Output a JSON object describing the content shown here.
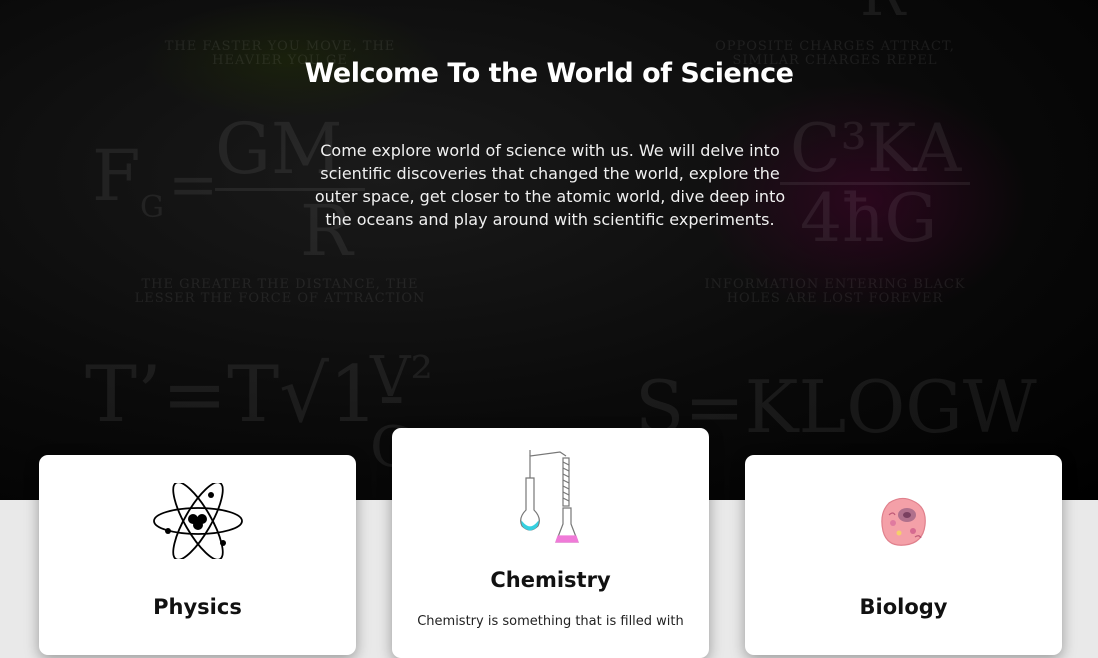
{
  "hero": {
    "title": "Welcome To the World of Science",
    "text": "Come explore world of science with us. We will delve into scientific discoveries that changed the world, explore the outer space, get closer to the atomic world, dive deep into the oceans and play around with scientific experiments."
  },
  "background": {
    "formula_gravity": "F",
    "formula_gravity_sub": "G",
    "formula_gravity_eq": "=",
    "formula_gravity_num": "GM",
    "formula_gravity_den": "R",
    "formula_entropy_top": "C³KA",
    "formula_entropy_bottom": "4ħG",
    "formula_time": "T’=T√1-",
    "formula_time_num": "V²",
    "formula_time_den": "C",
    "formula_boltzmann": "S=KLOGW",
    "formula_top_right": "R",
    "caption_top_left": "The Faster you move, The Heavier you Ge",
    "caption_top_right": "Opposite Charges Attract, Similar Charges Repel",
    "caption_mid_left": "The Greater the Distance, The Lesser the Force of Attraction",
    "caption_mid_right": "Information Entering Black Holes are Lost Forever"
  },
  "cards": {
    "physics": {
      "title": "Physics",
      "icon": "atom-icon"
    },
    "chemistry": {
      "title": "Chemistry",
      "icon": "lab-flask-icon",
      "desc": "Chemistry is something that is filled with"
    },
    "biology": {
      "title": "Biology",
      "icon": "cell-icon"
    }
  },
  "colors": {
    "hero_bg": "#000000",
    "page_bg": "#e9e9e9",
    "card_bg": "#ffffff",
    "flask_liquid_cyan": "#35d0e0",
    "flask_liquid_pink": "#f07ad8",
    "cell_pink": "#f4a0a8"
  }
}
